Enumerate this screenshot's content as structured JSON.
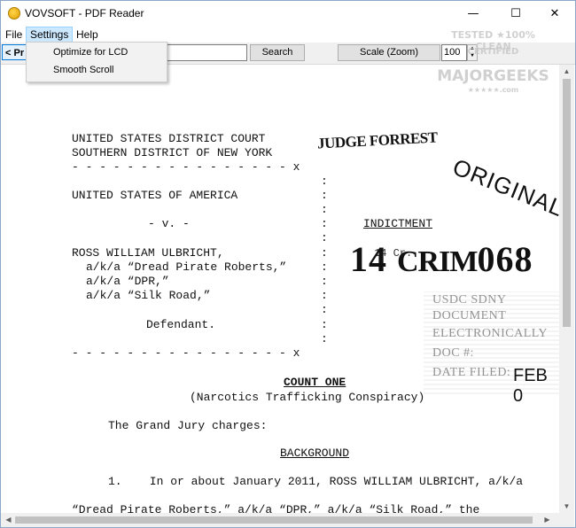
{
  "window": {
    "title": "VOVSOFT - PDF Reader",
    "minimize_glyph": "—",
    "maximize_glyph": "☐",
    "close_glyph": "✕"
  },
  "menu": {
    "file": "File",
    "settings": "Settings",
    "help": "Help"
  },
  "settings_menu": {
    "items": [
      "Optimize for LCD",
      "Smooth Scroll"
    ]
  },
  "toolbar": {
    "prev_label": "< Pr",
    "search_value": "",
    "search_button": "Search",
    "scale_button": "Scale (Zoom)",
    "zoom_value": "100"
  },
  "watermark": {
    "line1": "TESTED ★100% CLEAN",
    "line2": "CERTIFIED",
    "line3": "MAJORGEEKS",
    "line4": "★★★★★.com"
  },
  "document": {
    "court_line1": "UNITED STATES DISTRICT COURT",
    "court_line2": "SOUTHERN DISTRICT OF NEW YORK",
    "divider": "- - - - - - - - - - - - - - - - x",
    "plaintiff": "UNITED STATES OF AMERICA",
    "versus": "- v. -",
    "indictment": "INDICTMENT",
    "defendant_name": "ROSS WILLIAM ULBRICHT,",
    "aka1": "a/k/a “Dread Pirate Roberts,”",
    "aka2": "a/k/a “DPR,”",
    "aka3": "a/k/a “Silk Road,”",
    "defendant_label": "Defendant.",
    "count_title": "COUNT ONE",
    "count_subtitle": "(Narcotics Trafficking Conspiracy)",
    "charges": "The Grand Jury charges:",
    "background": "BACKGROUND",
    "para1_line1": "1.    In or about January 2011, ROSS WILLIAM ULBRICHT, a/k/a",
    "para1_line2": "“Dread Pirate Roberts,” a/k/a “DPR,” a/k/a “Silk Road,” the",
    "colon": ":"
  },
  "stamps": {
    "judge": "JUDGE FORREST",
    "original": "ORIGINAL",
    "case_prefix": "14",
    "case_crim": "CRIM",
    "case_number": "068",
    "case_small": "14 Cr.",
    "ecf_line1": "USDC SDNY",
    "ecf_line2": "DOCUMENT",
    "ecf_line3": "ELECTRONICALLY",
    "ecf_line4": "DOC #:",
    "ecf_line5": "DATE FILED:",
    "feb": "FEB 0"
  }
}
